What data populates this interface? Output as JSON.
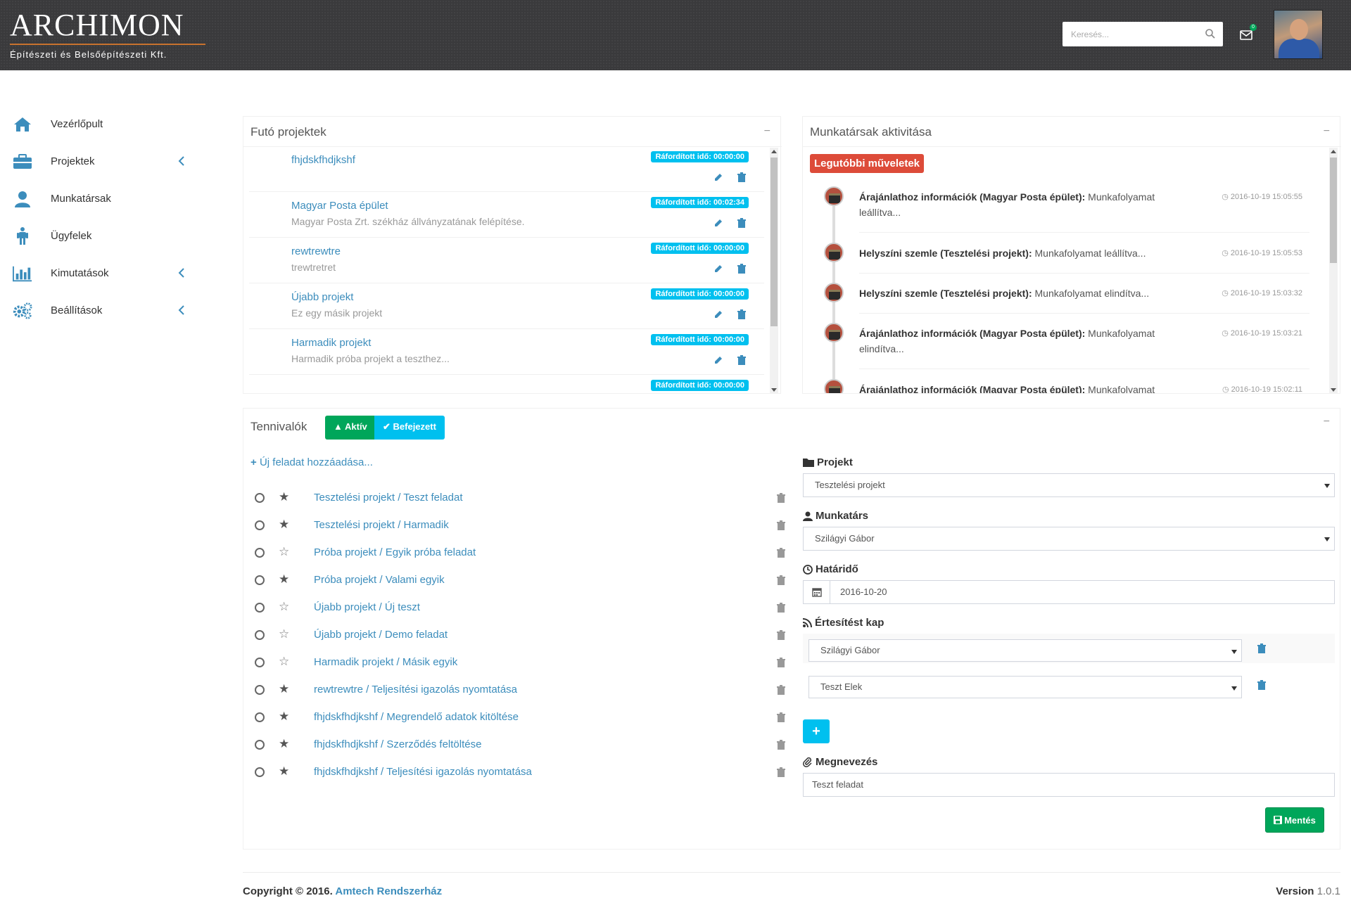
{
  "brand": {
    "title": "ARCHIMON",
    "subtitle": "Építészeti és Belsőépítészeti Kft."
  },
  "header": {
    "search_placeholder": "Keresés...",
    "mail_badge": "0"
  },
  "sidebar": {
    "items": [
      {
        "label": "Vezérlőpult"
      },
      {
        "label": "Projektek"
      },
      {
        "label": "Munkatársak"
      },
      {
        "label": "Ügyfelek"
      },
      {
        "label": "Kimutatások"
      },
      {
        "label": "Beállítások"
      }
    ]
  },
  "projects_panel": {
    "title": "Futó projektek",
    "collapse": "−",
    "items": [
      {
        "name": "fhjdskfhdjkshf",
        "desc": "",
        "time": "Ráfordított idő: 00:00:00"
      },
      {
        "name": "Magyar Posta épület",
        "desc": "Magyar Posta Zrt. székház állványzatának felépítése.",
        "time": "Ráfordított idő: 00:02:34"
      },
      {
        "name": "rewtrewtre",
        "desc": "trewtretret",
        "time": "Ráfordított idő: 00:00:00"
      },
      {
        "name": "Újabb projekt",
        "desc": "Ez egy másik projekt",
        "time": "Ráfordított idő: 00:00:00"
      },
      {
        "name": "Harmadik projekt",
        "desc": "Harmadik próba projekt a teszthez...",
        "time": "Ráfordított idő: 00:00:00"
      },
      {
        "name": "",
        "desc": "",
        "time": "Ráfordított idő: 00:00:00"
      }
    ]
  },
  "activity_panel": {
    "title": "Munkatársak aktivitása",
    "collapse": "−",
    "label": "Legutóbbi műveletek",
    "items": [
      {
        "subject": "Árajánlathoz információk (Magyar Posta épület):",
        "action": " Munkafolyamat leállítva...",
        "time": "2016-10-19 15:05:55"
      },
      {
        "subject": "Helyszíni szemle (Tesztelési projekt):",
        "action": " Munkafolyamat leállítva...",
        "time": "2016-10-19 15:05:53"
      },
      {
        "subject": "Helyszíni szemle (Tesztelési projekt):",
        "action": " Munkafolyamat elindítva...",
        "time": "2016-10-19 15:03:32"
      },
      {
        "subject": "Árajánlathoz információk (Magyar Posta épület):",
        "action": " Munkafolyamat elindítva...",
        "time": "2016-10-19 15:03:21"
      },
      {
        "subject": "Árajánlathoz információk (Magyar Posta épület):",
        "action": " Munkafolyamat",
        "time": "2016-10-19 15:02:11"
      }
    ]
  },
  "todo_panel": {
    "title": "Tennivalók",
    "collapse": "−",
    "tab_active": "Aktív",
    "tab_done": "Befejezett",
    "add_task": "Új feladat hozzáadása...",
    "items": [
      {
        "text": "Tesztelési projekt / Teszt feladat",
        "starred": true
      },
      {
        "text": "Tesztelési projekt / Harmadik",
        "starred": true
      },
      {
        "text": "Próba projekt / Egyik próba feladat",
        "starred": false
      },
      {
        "text": "Próba projekt / Valami egyik",
        "starred": true
      },
      {
        "text": "Újabb projekt / Új teszt",
        "starred": false
      },
      {
        "text": "Újabb projekt / Demo feladat",
        "starred": false
      },
      {
        "text": "Harmadik projekt / Másik egyik",
        "starred": false
      },
      {
        "text": "rewtrewtre / Teljesítési igazolás nyomtatása",
        "starred": true
      },
      {
        "text": "fhjdskfhdjkshf / Megrendelő adatok kitöltése",
        "starred": true
      },
      {
        "text": "fhjdskfhdjkshf / Szerződés feltöltése",
        "starred": true
      },
      {
        "text": "fhjdskfhdjkshf / Teljesítési igazolás nyomtatása",
        "starred": true
      }
    ],
    "form": {
      "project_label": "Projekt",
      "project_value": "Tesztelési projekt",
      "employee_label": "Munkatárs",
      "employee_value": "Szilágyi Gábor",
      "deadline_label": "Határidő",
      "deadline_value": "2016-10-20",
      "notify_label": "Értesítést kap",
      "notify_values": [
        "Szilágyi Gábor",
        "Teszt Elek"
      ],
      "add_label": "+",
      "name_label": "Megnevezés",
      "name_value": "Teszt feladat",
      "save_label": "Mentés"
    }
  },
  "footer": {
    "copyright": "Copyright © 2016. ",
    "company": "Amtech Rendszerház",
    "version_label": "Version",
    "version_value": " 1.0.1"
  },
  "colors": {
    "accent": "#3c8dbc",
    "green": "#00a65a",
    "aqua": "#00c0ef",
    "red": "#dd4b39"
  }
}
